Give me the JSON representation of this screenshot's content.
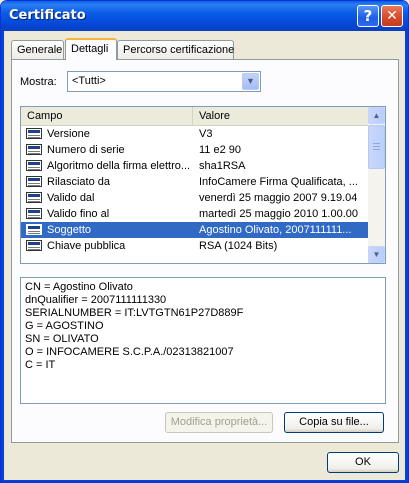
{
  "window": {
    "title": "Certificato"
  },
  "titlebar": {
    "help_glyph": "?",
    "close_glyph": "✕"
  },
  "tabs": [
    {
      "label": "Generale"
    },
    {
      "label": "Dettagli"
    },
    {
      "label": "Percorso certificazione"
    }
  ],
  "active_tab": "Dettagli",
  "filter": {
    "label": "Mostra:",
    "selected": "<Tutti>"
  },
  "fields_table": {
    "columns": [
      "Campo",
      "Valore"
    ],
    "rows": [
      {
        "field": "Versione",
        "value": "V3"
      },
      {
        "field": "Numero di serie",
        "value": "11 e2 90"
      },
      {
        "field": "Algoritmo della firma elettro...",
        "value": "sha1RSA"
      },
      {
        "field": "Rilasciato da",
        "value": "InfoCamere Firma Qualificata, ..."
      },
      {
        "field": "Valido dal",
        "value": "venerdì 25 maggio 2007 9.19.04"
      },
      {
        "field": "Valido fino al",
        "value": "martedì 25 maggio 2010 1.00.00"
      },
      {
        "field": "Soggetto",
        "value": "Agostino Olivato, 2007111111..."
      },
      {
        "field": "Chiave pubblica",
        "value": "RSA (1024 Bits)"
      }
    ],
    "selected_row": "Soggetto"
  },
  "details_text": [
    "CN = Agostino Olivato",
    "dnQualifier = 2007111111330",
    "SERIALNUMBER = IT:LVTGTN61P27D889F",
    "G = AGOSTINO",
    "SN = OLIVATO",
    "O = INFOCAMERE S.C.P.A./02313821007",
    "C = IT"
  ],
  "buttons": {
    "edit_properties": "Modifica proprietà...",
    "copy_to_file": "Copia su file...",
    "ok": "OK"
  },
  "icons": {
    "row_icon": "certificate-field-icon",
    "dropdown": "chevron-down-icon"
  },
  "colors": {
    "title_bar": "#0b5ce6",
    "selection": "#316ac5",
    "active_tab_accent": "#f7b33d"
  }
}
